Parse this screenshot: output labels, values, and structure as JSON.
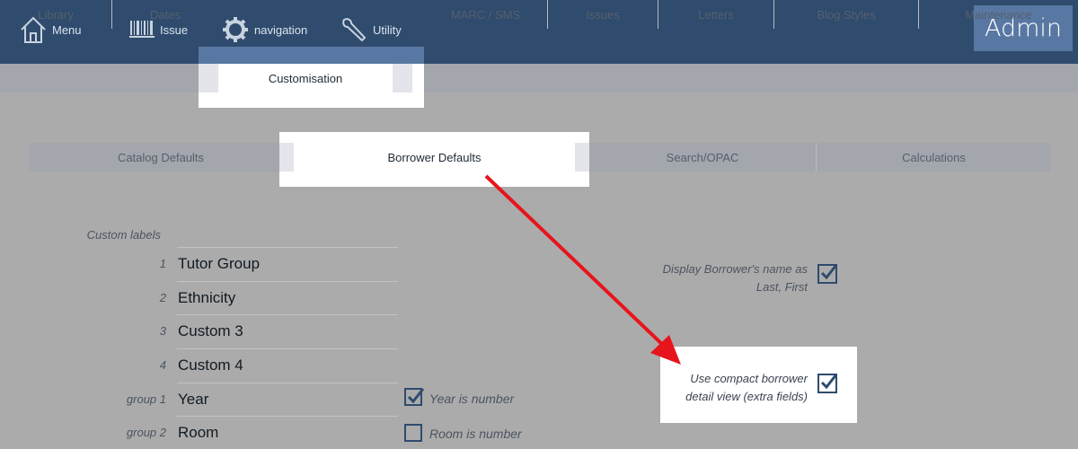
{
  "topnav": {
    "menu_label": "Menu",
    "issue_label": "Issue",
    "navigation_label": "navigation",
    "utility_label": "Utility",
    "admin_label": "Admin"
  },
  "tabs": [
    "Library",
    "Dates",
    "Customisation",
    "MARC / SMS",
    "Issues",
    "Letters",
    "Blog Styles",
    "Maintenance"
  ],
  "active_tab": "Customisation",
  "subtabs": [
    "Catalog Defaults",
    "Borrower Defaults",
    "Search/OPAC",
    "Calculations"
  ],
  "active_subtab": "Borrower Defaults",
  "custom_labels": {
    "heading": "Custom labels",
    "rows": [
      {
        "num": "1",
        "value": "Tutor Group"
      },
      {
        "num": "2",
        "value": "Ethnicity"
      },
      {
        "num": "3",
        "value": "Custom 3"
      },
      {
        "num": "4",
        "value": "Custom 4"
      },
      {
        "num": "group 1",
        "value": "Year"
      },
      {
        "num": "group 2",
        "value": "Room"
      }
    ],
    "year_is_number": {
      "label": "Year is number",
      "checked": true
    },
    "room_is_number": {
      "label": "Room is number",
      "checked": false
    }
  },
  "options": {
    "display_name_line1": "Display Borrower's name as",
    "display_name_line2": "Last, First",
    "display_name_checked": true,
    "compact_line1": "Use compact borrower",
    "compact_line2": "detail view (extra fields)",
    "compact_checked": true
  },
  "colors": {
    "header": "#2f4b6d",
    "admin": "#5878a3",
    "overlay": "#ababab",
    "arrow": "#e8141b"
  }
}
